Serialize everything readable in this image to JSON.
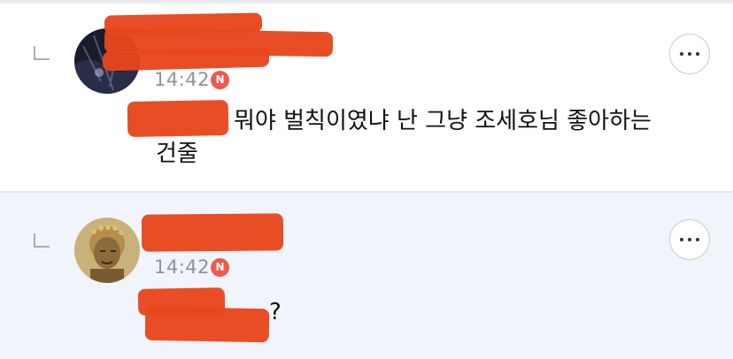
{
  "comments": [
    {
      "time": "14:42",
      "new_badge": "N",
      "line1": "뭐야 벌칙이였냐 난 그냥 조세호님 좋아하는",
      "line2": "건줄"
    },
    {
      "time": "14:42",
      "new_badge": "N",
      "line1": "?"
    }
  ],
  "icons": {
    "reply": "reply-arrow-icon",
    "more": "more-options-icon",
    "new": "new-badge-icon"
  },
  "colors": {
    "new_badge": "#ee5a4d",
    "highlight_bg": "#f1f4fb",
    "redaction": "#e8461c"
  }
}
